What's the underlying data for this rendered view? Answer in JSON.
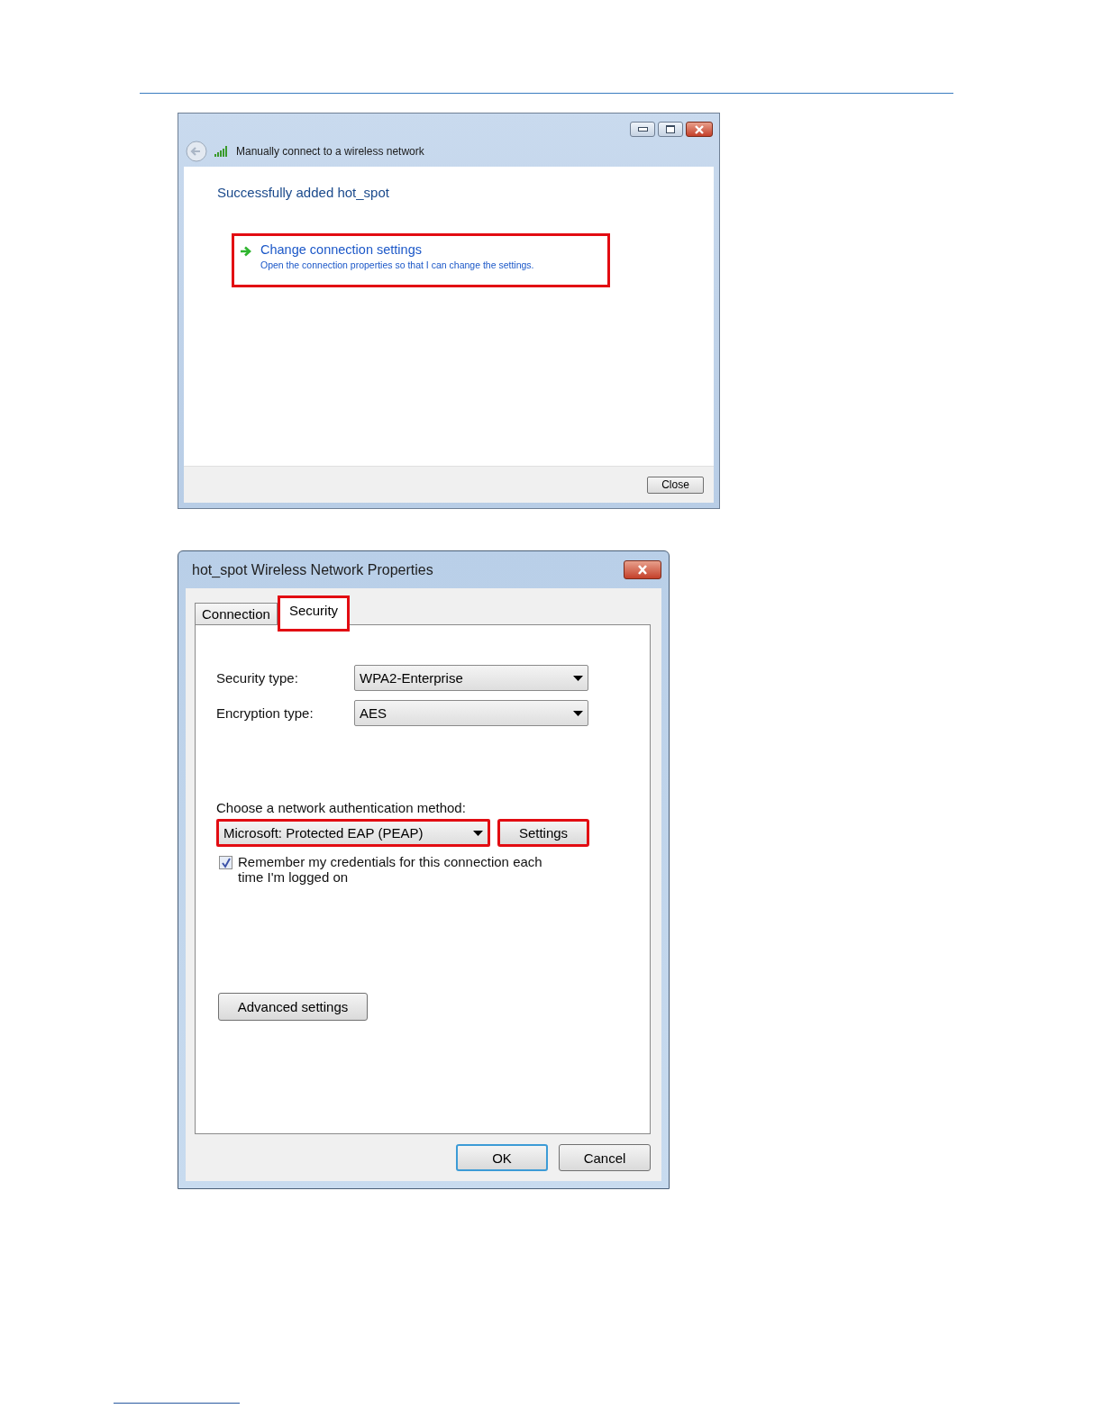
{
  "wizard": {
    "title": "Manually connect to a wireless network",
    "heading": "Successfully added hot_spot",
    "option": {
      "title": "Change connection settings",
      "description": "Open the connection properties so that I can change the settings.",
      "highlighted": true
    },
    "buttons": [
      {
        "label": "Close"
      }
    ]
  },
  "properties": {
    "title": "hot_spot Wireless Network Properties",
    "tabs": [
      {
        "label": "Connection",
        "selected": false,
        "highlighted": false
      },
      {
        "label": "Security",
        "selected": true,
        "highlighted": true
      }
    ],
    "fields": [
      {
        "label": "Security type:",
        "value": "WPA2-Enterprise"
      },
      {
        "label": "Encryption type:",
        "value": "AES"
      }
    ],
    "auth": {
      "label": "Choose a network authentication method:",
      "value": "Microsoft: Protected EAP (PEAP)",
      "highlighted": true,
      "button": {
        "label": "Settings",
        "highlighted": true
      }
    },
    "remember": {
      "label": "Remember my credentials for this connection each time I'm logged on",
      "checked": true
    },
    "advanced_button": "Advanced settings",
    "buttons": [
      {
        "label": "OK",
        "default": true
      },
      {
        "label": "Cancel",
        "default": false
      }
    ]
  }
}
